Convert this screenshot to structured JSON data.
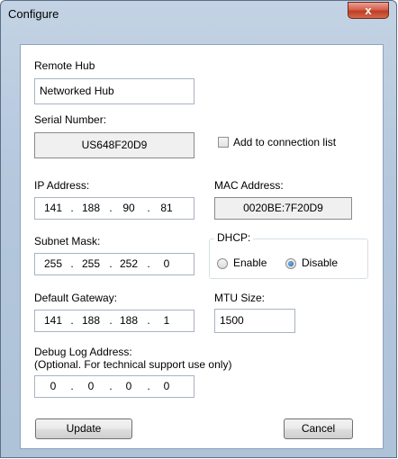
{
  "window": {
    "title": "Configure",
    "close_glyph": "x"
  },
  "remote_hub": {
    "label": "Remote Hub",
    "value": "Networked Hub"
  },
  "serial": {
    "label": "Serial Number:",
    "value": "US648F20D9"
  },
  "add_to_list": {
    "label": "Add to connection list",
    "checked": false
  },
  "ip_address": {
    "label": "IP Address:",
    "octets": [
      "141",
      "188",
      "90",
      "81"
    ]
  },
  "mac_address": {
    "label": "MAC Address:",
    "value": "0020BE:7F20D9"
  },
  "subnet_mask": {
    "label": "Subnet Mask:",
    "octets": [
      "255",
      "255",
      "252",
      "0"
    ]
  },
  "dhcp": {
    "label": "DHCP:",
    "enable_label": "Enable",
    "disable_label": "Disable",
    "selected": "Disable"
  },
  "default_gateway": {
    "label": "Default Gateway:",
    "octets": [
      "141",
      "188",
      "188",
      "1"
    ]
  },
  "mtu": {
    "label": "MTU Size:",
    "value": "1500"
  },
  "debug_log": {
    "label": "Debug Log Address:",
    "sublabel": "(Optional. For technical support use only)",
    "octets": [
      "0",
      "0",
      "0",
      "0"
    ]
  },
  "buttons": {
    "update": "Update",
    "cancel": "Cancel"
  },
  "dot": "."
}
